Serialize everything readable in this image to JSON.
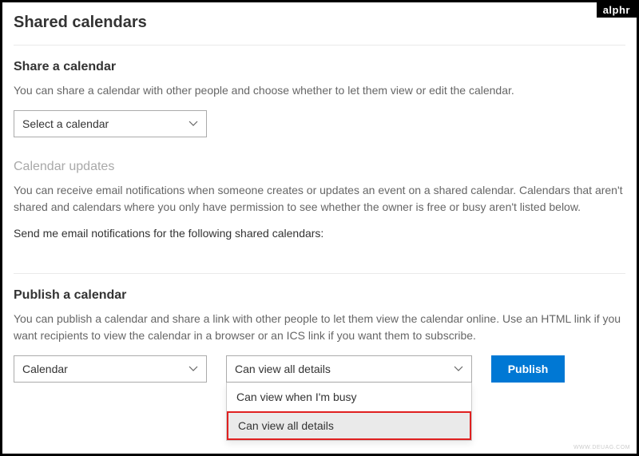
{
  "page": {
    "title": "Shared calendars"
  },
  "share": {
    "heading": "Share a calendar",
    "desc": "You can share a calendar with other people and choose whether to let them view or edit the calendar.",
    "dropdown_label": "Select a calendar"
  },
  "updates": {
    "heading": "Calendar updates",
    "desc": "You can receive email notifications when someone creates or updates an event on a shared calendar. Calendars that aren't shared and calendars where you only have permission to see whether the owner is free or busy aren't listed below.",
    "sublabel": "Send me email notifications for the following shared calendars:"
  },
  "publish": {
    "heading": "Publish a calendar",
    "desc": "You can publish a calendar and share a link with other people to let them view the calendar online. Use an HTML link if you want recipients to view the calendar in a browser or an ICS link if you want them to subscribe.",
    "calendar_dropdown": "Calendar",
    "permission_selected": "Can view all details",
    "permission_options": [
      "Can view when I'm busy",
      "Can view all details"
    ],
    "button": "Publish"
  },
  "watermark": {
    "topright": "alphr",
    "bottom": "WWW.DEUAG.COM"
  }
}
